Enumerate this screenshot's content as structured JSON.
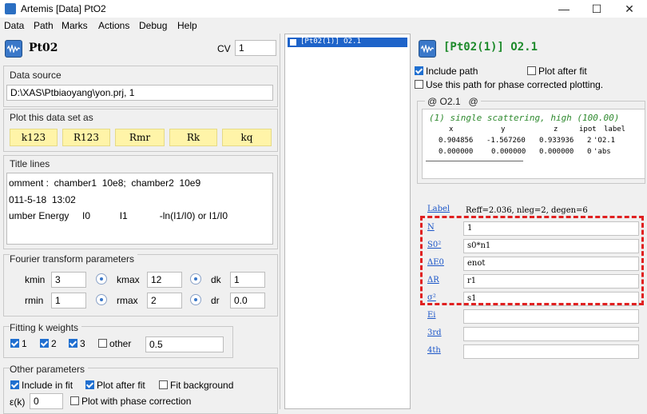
{
  "window": {
    "title": "Artemis [Data] PtO2",
    "minimize": "—",
    "maximize": "☐",
    "close": "✕"
  },
  "menu": [
    "Data",
    "Path",
    "Marks",
    "Actions",
    "Debug",
    "Help"
  ],
  "left": {
    "name": "Pt02",
    "cv_label": "CV",
    "cv_value": "1",
    "data_source_label": "Data source",
    "data_source_value": "D:\\XAS\\Ptbiaoyang\\yon.prj, 1",
    "plot_label": "Plot this data set as",
    "plot_buttons": [
      "k123",
      "R123",
      "Rmr",
      "Rk",
      "kq"
    ],
    "title_lines_label": "Title lines",
    "title_lines": [
      "omment :  chamber1  10e8;  chamber2  10e9",
      "011-5-18  13:02",
      "umber Energy     I0           I1            -ln(I1/I0) or I1/I0"
    ],
    "fourier": {
      "label": "Fourier transform parameters",
      "kmin_label": "kmin",
      "kmin": "3",
      "kmax_label": "kmax",
      "kmax": "12",
      "dk_label": "dk",
      "dk": "1",
      "rmin_label": "rmin",
      "rmin": "1",
      "rmax_label": "rmax",
      "rmax": "2",
      "dr_label": "dr",
      "dr": "0.0"
    },
    "kweights": {
      "label": "Fitting k weights",
      "w1": "1",
      "w2": "2",
      "w3": "3",
      "other_label": "other",
      "other_value": "0.5"
    },
    "other_params": {
      "label": "Other parameters",
      "include_in_fit": "Include in fit",
      "plot_after_fit": "Plot after fit",
      "fit_background": "Fit background",
      "ek_label": "ε(k)",
      "ek_value": "0",
      "plot_phase": "Plot with phase correction"
    }
  },
  "pathlist": {
    "item": "[Pt02(1)] O2.1"
  },
  "right": {
    "title": "[Pt02(1)] O2.1",
    "include_path": "Include path",
    "plot_after_fit": "Plot after fit",
    "phase_corrected": "Use this path for phase corrected plotting.",
    "group_label": "@ O2.1   @",
    "scattering_title": "(1) single scattering, high (100.00)",
    "table_header": [
      "x",
      "y",
      "z",
      "ipot",
      "label"
    ],
    "table_rows": [
      [
        "0.904856",
        "-1.567260",
        "0.933936",
        "2",
        "'O2.1"
      ],
      [
        "0.000000",
        "0.000000",
        "0.000000",
        "0",
        "'abs"
      ]
    ],
    "label_link": "Label",
    "label_value": "Reff=2.036, nleg=2, degen=6",
    "params": [
      {
        "link": "N",
        "value": "1"
      },
      {
        "link": "S0²",
        "value": "s0*n1"
      },
      {
        "link": "ΔE0",
        "value": "enot"
      },
      {
        "link": "ΔR",
        "value": "r1"
      },
      {
        "link": "σ²",
        "value": "s1"
      },
      {
        "link": "Ei",
        "value": ""
      },
      {
        "link": "3rd",
        "value": ""
      },
      {
        "link": "4th",
        "value": ""
      }
    ],
    "highlight_color": "#e02020"
  }
}
